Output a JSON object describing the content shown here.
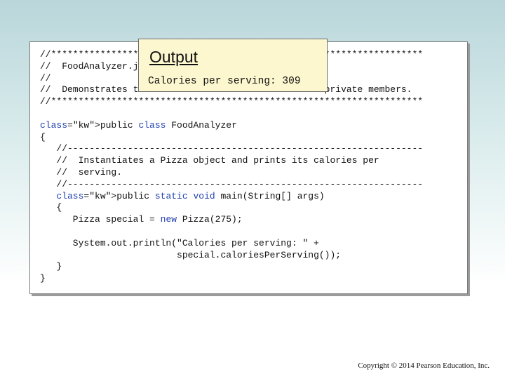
{
  "code_lines": [
    "//********************************************************************",
    "//  FoodAnalyzer.java       Author: Lewis/Loftus",
    "//",
    "//  Demonstrates the use of an inherited method and private members.",
    "//********************************************************************",
    "",
    "public class FoodAnalyzer",
    "{",
    "   //-----------------------------------------------------------------",
    "   //  Instantiates a Pizza object and prints its calories per",
    "   //  serving.",
    "   //-----------------------------------------------------------------",
    "   public static void main(String[] args)",
    "   {",
    "      Pizza special = new Pizza(275);",
    "",
    "      System.out.println(\"Calories per serving: \" +",
    "                         special.caloriesPerServing());",
    "   }",
    "}"
  ],
  "output": {
    "title": "Output",
    "text": "Calories per serving: 309"
  },
  "footer": {
    "copyright": "Copyright © 2014 Pearson Education, Inc."
  }
}
